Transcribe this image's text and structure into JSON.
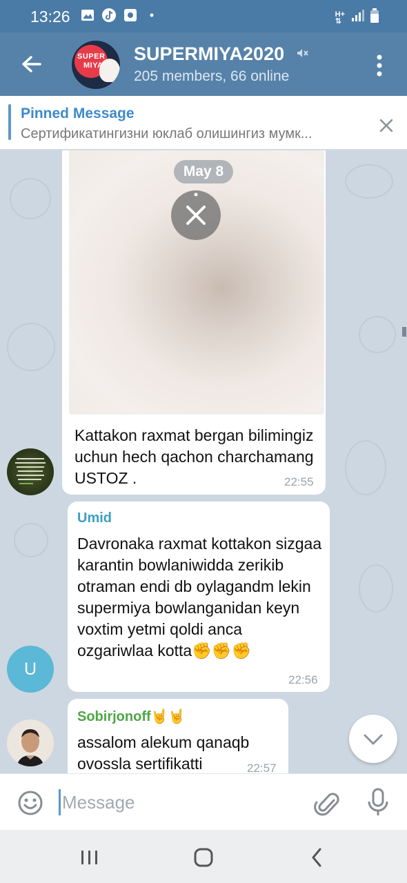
{
  "status_bar": {
    "time": "13:26",
    "icons": [
      "gallery-icon",
      "tiktok-icon",
      "screen-record-icon",
      "dot-icon",
      "network-h-plus-icon",
      "signal-icon",
      "battery-icon"
    ]
  },
  "header": {
    "title": "SUPERMIYA2020",
    "subtitle": "205 members, 66 online",
    "avatar_text_line1": "SUPER",
    "avatar_text_line2": "MIYA",
    "accent_color": "#5682a9"
  },
  "pinned": {
    "title": "Pinned Message",
    "text": "Сертификатингизни юклаб олишингиз мумк..."
  },
  "chat": {
    "date_chip": "May 8",
    "messages": [
      {
        "text": "Kattakon raxmat bergan bilimingiz uchun hech qachon charchamang USTOZ .",
        "time": "22:55",
        "has_photo": true
      },
      {
        "sender": "Umid",
        "sender_color": "#3d9fc1",
        "avatar_letter": "U",
        "text": "Davronaka raxmat kottakon sizgaa karantin bowlaniwidda zerikib otraman endi db oylagandm lekin supermiya bowlanganidan keyn voxtim yetmi qoldi anca ozgariwlaa kotta✊✊✊",
        "time": "22:56"
      },
      {
        "sender": "Sobirjonoff🤘🤘",
        "sender_color": "#4ca744",
        "text": "assalom alekum qanaqb ovossla sertifikatti",
        "time": "22:57"
      }
    ]
  },
  "input": {
    "placeholder": "Message"
  },
  "colors": {
    "header": "#5682a9",
    "status_bar": "#4a7ba6",
    "pinned_accent": "#3d8acb",
    "chat_bg": "#ccd7e1"
  }
}
